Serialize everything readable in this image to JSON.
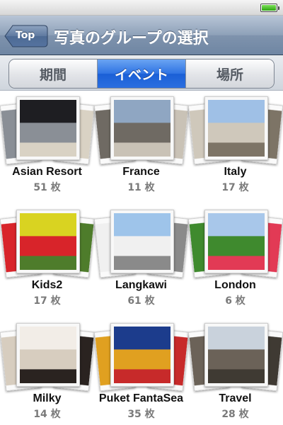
{
  "navbar": {
    "back_label": "Top",
    "title": "写真のグループの選択"
  },
  "segments": [
    {
      "label": "期間",
      "active": false
    },
    {
      "label": "イベント",
      "active": true
    },
    {
      "label": "場所",
      "active": false
    }
  ],
  "albums": [
    {
      "name": "Asian Resort",
      "count": "51 枚",
      "colors": [
        "#1e1e22",
        "#8a8f96",
        "#d9d2c4"
      ]
    },
    {
      "name": "France",
      "count": "11 枚",
      "colors": [
        "#8fa6c2",
        "#6f6a63",
        "#c9c2b6"
      ]
    },
    {
      "name": "Italy",
      "count": "17 枚",
      "colors": [
        "#9fc0e6",
        "#cfc8bb",
        "#7d7466"
      ]
    },
    {
      "name": "Kids2",
      "count": "17 枚",
      "colors": [
        "#d9d321",
        "#d8242a",
        "#4e7c2b"
      ]
    },
    {
      "name": "Langkawi",
      "count": "61 枚",
      "colors": [
        "#9ec4ea",
        "#f0f0f0",
        "#8a8a8a"
      ]
    },
    {
      "name": "London",
      "count": "6 枚",
      "colors": [
        "#a8c7ea",
        "#3f8a2e",
        "#e23a55"
      ]
    },
    {
      "name": "Milky",
      "count": "14 枚",
      "colors": [
        "#f2ede7",
        "#d7cdbf",
        "#2a2320"
      ]
    },
    {
      "name": "Puket FantaSea",
      "count": "35 枚",
      "colors": [
        "#1c3c8c",
        "#e0a020",
        "#c72a2a"
      ]
    },
    {
      "name": "Travel",
      "count": "28 枚",
      "colors": [
        "#c9d2dc",
        "#6b6258",
        "#3f3a33"
      ]
    }
  ]
}
